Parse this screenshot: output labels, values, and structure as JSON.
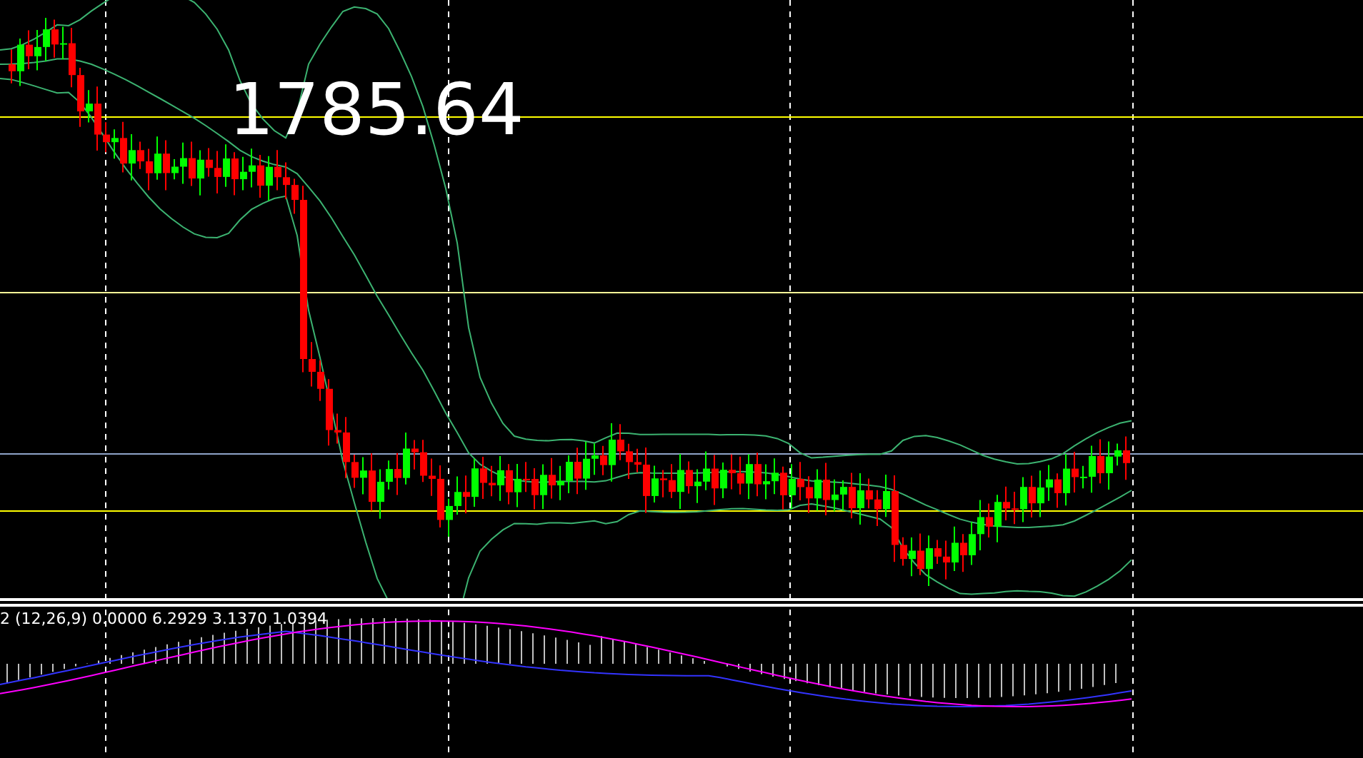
{
  "price_label": "1785.64",
  "indicator_label": "2 (12,26,9) 0.0000 6.2929 3.1370 1.0394"
}
